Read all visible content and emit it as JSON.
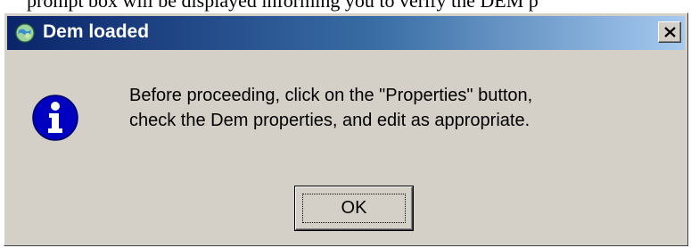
{
  "background_caption": {
    "text": "prompt box will be displayed informing you to verify the DEM p"
  },
  "dialog": {
    "title": "Dem loaded",
    "app_icon": "globe-icon",
    "close_icon": "close-icon",
    "message_icon": "info-icon",
    "message_lines": [
      "Before proceeding, click on the \"Properties\" button,",
      "check the Dem properties, and edit as appropriate."
    ],
    "ok_label": "OK"
  },
  "colors": {
    "title_gradient_start": "#0a246a",
    "title_gradient_end": "#a6caf0",
    "dialog_face": "#d4d0c8",
    "info_icon_blue": "#0000c0"
  }
}
